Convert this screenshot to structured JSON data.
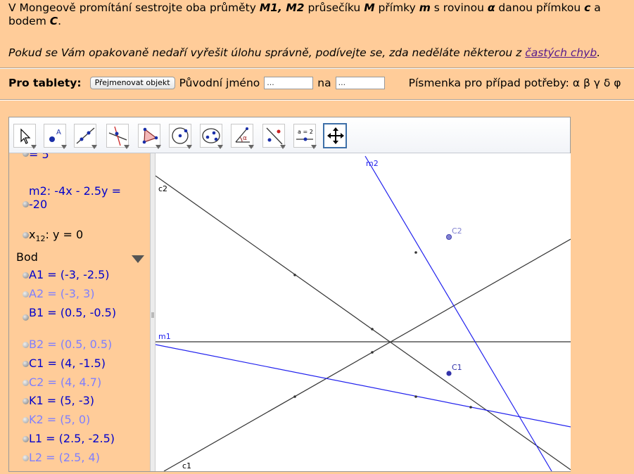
{
  "task": {
    "text_parts": [
      {
        "t": "V Mongeově promítání sestrojte oba průměty ",
        "s": "n"
      },
      {
        "t": "M1, M2",
        "s": "bi"
      },
      {
        "t": " průsečíku ",
        "s": "n"
      },
      {
        "t": "M",
        "s": "bi"
      },
      {
        "t": " přímky ",
        "s": "n"
      },
      {
        "t": "m",
        "s": "bi"
      },
      {
        "t": " s rovinou ",
        "s": "n"
      },
      {
        "t": "α",
        "s": "bi"
      },
      {
        "t": " danou přímkou ",
        "s": "n"
      },
      {
        "t": "c",
        "s": "bi"
      },
      {
        "t": " a bodem ",
        "s": "n"
      },
      {
        "t": "C",
        "s": "bi"
      },
      {
        "t": ".",
        "s": "n"
      }
    ],
    "hint_prefix": "Pokud se Vám opakovaně nedaří vyřešit úlohu správně, podívejte se, zda neděláte některou z ",
    "hint_link": "častých chyb",
    "hint_suffix": "."
  },
  "tablet": {
    "label": "Pro tablety:",
    "rename_button": "Přejmenovat objekt",
    "original_name_label": "Původní jméno",
    "original_name_value": "...",
    "to_label": "na",
    "to_value": "...",
    "letters": "Písmenka pro případ potřeby: α β γ δ φ"
  },
  "toolbar": {
    "tools": [
      "move-tool",
      "point-tool",
      "line-tool",
      "perpendicular-line-tool",
      "polygon-tool",
      "circle-tool",
      "conic-tool",
      "angle-tool",
      "reflect-tool",
      "slider-tool",
      "move-graphics-view-tool"
    ],
    "selected": "move-graphics-view-tool",
    "slider_icon_text": "a = 2"
  },
  "algebra": {
    "partial_top": "= 5",
    "m2_line1": "m2: -4x - 2.5y =",
    "m2_line2": "-20",
    "x12_prefix": "x",
    "x12_sub": "12",
    "x12_rest": ": y = 0",
    "category": "Bod",
    "points": [
      {
        "text": "A1 = (-3, -2.5)",
        "color": "#0000cc"
      },
      {
        "text": "A2 = (-3, 3)",
        "color": "#7f7fff"
      },
      {
        "text": "B1 = (0.5, -0.5)",
        "color": "#0000cc"
      },
      {
        "text": "B2 = (0.5, 0.5)",
        "color": "#7f7fff"
      },
      {
        "text": "C1 = (4, -1.5)",
        "color": "#0000cc"
      },
      {
        "text": "C2 = (4, 4.7)",
        "color": "#7f7fff"
      },
      {
        "text": "K1 = (5, -3)",
        "color": "#0000cc"
      },
      {
        "text": "K2 = (5, 0)",
        "color": "#7f7fff"
      },
      {
        "text": "L1 = (2.5, -2.5)",
        "color": "#0000cc"
      },
      {
        "text": "L2 = (2.5, 4)",
        "color": "#7f7fff"
      }
    ]
  },
  "graphics": {
    "labels": {
      "c2": "c2",
      "m2": "m2",
      "C2": "C2",
      "m1": "m1",
      "C1": "C1",
      "c1": "c1"
    },
    "colors": {
      "blue": "#2222ee",
      "dark": "#333333",
      "point": "#3333aa",
      "point_light": "#8080d0"
    }
  }
}
